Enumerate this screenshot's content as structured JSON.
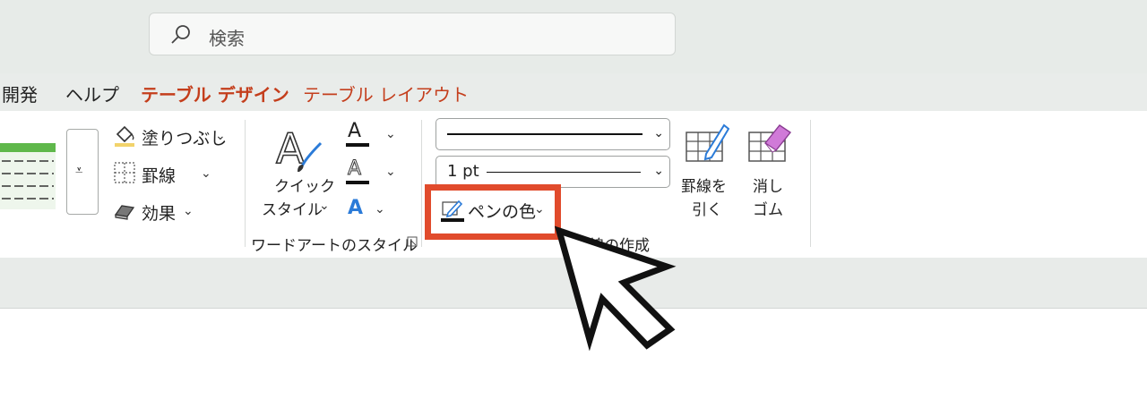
{
  "search": {
    "placeholder": "検索"
  },
  "tabs": [
    {
      "label": "開発"
    },
    {
      "label": "ヘルプ"
    },
    {
      "label": "テーブル デザイン"
    },
    {
      "label": "テーブル レイアウト"
    }
  ],
  "ribbon": {
    "shading": "塗りつぶし",
    "borders": "罫線",
    "effects": "効果",
    "quick_style_1": "クイック",
    "quick_style_2": "スタイル",
    "wordart_group": "ワードアートのスタイル",
    "line_weight": "1 pt",
    "pen_color": "ペンの色",
    "draw_group": "罫線の作成",
    "draw_table_1": "罫線を",
    "draw_table_2": "引く",
    "eraser_1": "消し",
    "eraser_2": "ゴム",
    "text_letter": "A"
  },
  "colors": {
    "accent": "#c43e1c",
    "highlight": "#e14b2c",
    "text_blue": "#2b7bd8"
  }
}
